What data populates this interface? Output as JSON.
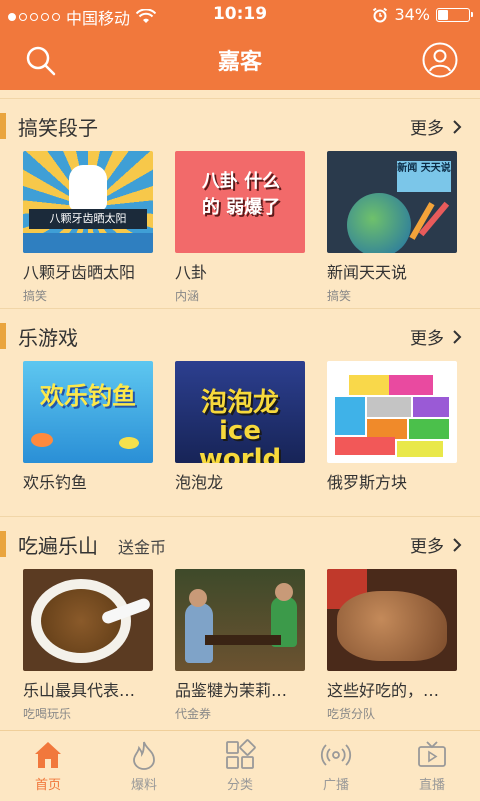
{
  "status_bar": {
    "carrier": "中国移动",
    "time": "10:19",
    "battery": "34%",
    "battery_level": 0.34
  },
  "nav": {
    "title": "嘉客"
  },
  "sections": [
    {
      "title": "搞笑段子",
      "subtitle": "",
      "more": "更多",
      "items": [
        {
          "title": "八颗牙齿晒太阳",
          "tag": "搞笑",
          "thumb_text": "八颗牙齿晒太阳"
        },
        {
          "title": "八卦",
          "tag": "内涵",
          "thumb_text": "八卦 什么的 弱爆了"
        },
        {
          "title": "新闻天天说",
          "tag": "搞笑",
          "thumb_text": "新闻 天天说"
        }
      ]
    },
    {
      "title": "乐游戏",
      "subtitle": "",
      "more": "更多",
      "items": [
        {
          "title": "欢乐钓鱼",
          "tag": "",
          "thumb_text": "欢乐钓鱼"
        },
        {
          "title": "泡泡龙",
          "tag": "",
          "thumb_text": "泡泡龙 ice world"
        },
        {
          "title": "俄罗斯方块",
          "tag": "",
          "thumb_text": ""
        }
      ]
    },
    {
      "title": "吃遍乐山",
      "subtitle": "送金币",
      "more": "更多",
      "items": [
        {
          "title": "乐山最具代表…",
          "tag": "吃喝玩乐",
          "thumb_text": ""
        },
        {
          "title": "品鉴犍为茉莉…",
          "tag": "代金券",
          "thumb_text": ""
        },
        {
          "title": "这些好吃的，…",
          "tag": "吃货分队",
          "thumb_text": ""
        }
      ]
    }
  ],
  "tabs": [
    {
      "label": "首页",
      "icon": "home-icon",
      "active": true
    },
    {
      "label": "爆料",
      "icon": "flame-icon",
      "active": false
    },
    {
      "label": "分类",
      "icon": "grid-icon",
      "active": false
    },
    {
      "label": "广播",
      "icon": "broadcast-icon",
      "active": false
    },
    {
      "label": "直播",
      "icon": "tv-icon",
      "active": false
    }
  ],
  "colors": {
    "accent": "#f1783c",
    "background": "#fde7c3",
    "section_mark": "#e9a43d"
  }
}
